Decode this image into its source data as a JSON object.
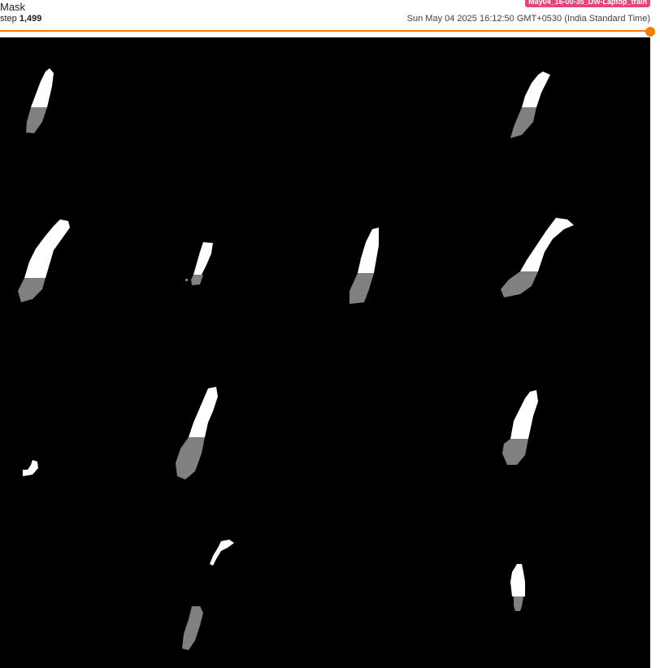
{
  "card": {
    "title": "Mask",
    "run_name": "May04_16-00-35_DW-Laptop_train",
    "step_label": "step",
    "step_value": "1,499",
    "timestamp": "Sun May 04 2025 16:12:50 GMT+0530 (India Standard Time)"
  },
  "slider": {
    "position_fraction": 1.0,
    "accent_color": "#f57c00"
  },
  "colors": {
    "run_badge": "#e8437a",
    "mask_background": "#000000",
    "mask_class_1": "#ffffff",
    "mask_class_2": "#808080"
  }
}
